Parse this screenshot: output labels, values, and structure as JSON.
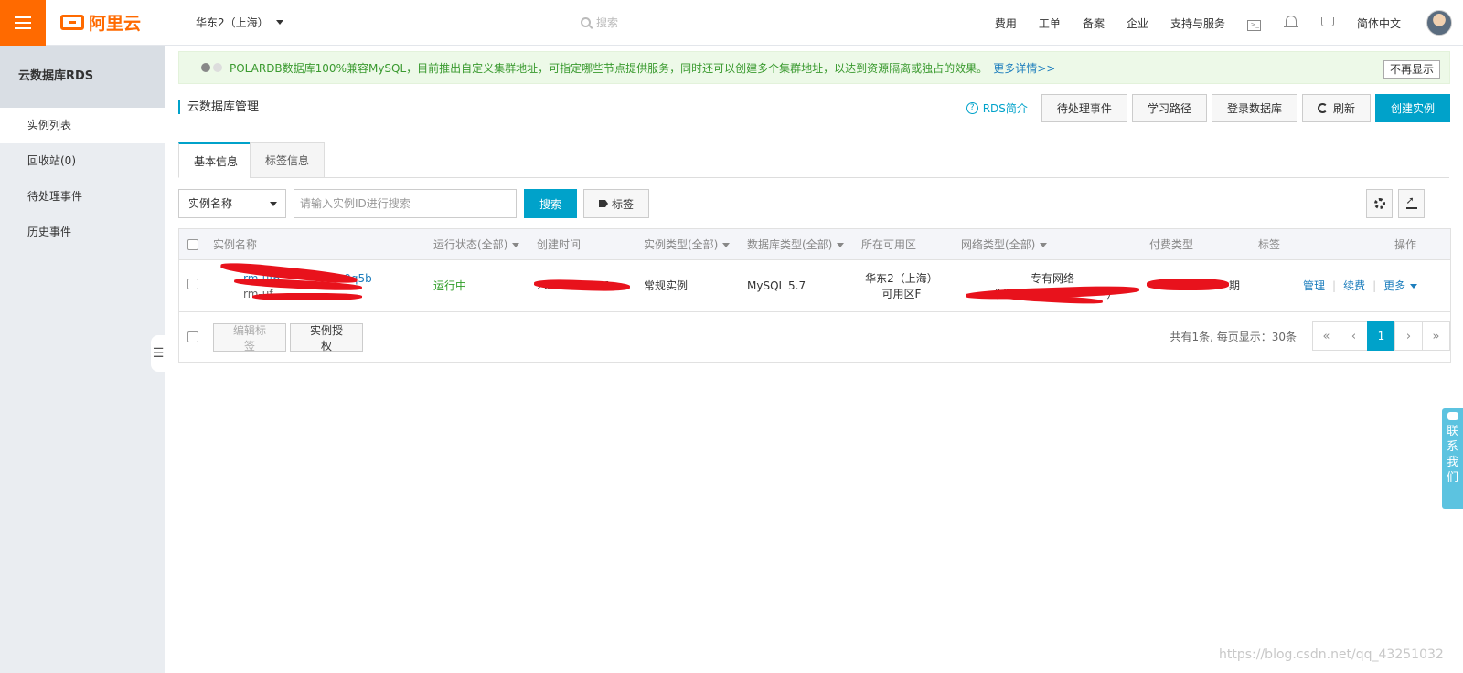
{
  "topbar": {
    "brand": "阿里云",
    "region": "华东2（上海）",
    "search_placeholder": "搜索",
    "links": [
      "费用",
      "工单",
      "备案",
      "企业",
      "支持与服务"
    ],
    "language": "简体中文"
  },
  "sidebar": {
    "title": "云数据库RDS",
    "items": [
      {
        "label": "实例列表"
      },
      {
        "label": "回收站(0)"
      },
      {
        "label": "待处理事件"
      },
      {
        "label": "历史事件"
      }
    ]
  },
  "notice": {
    "text": "POLARDB数据库100%兼容MySQL，目前推出自定义集群地址，可指定哪些节点提供服务，同时还可以创建多个集群地址，以达到资源隔离或独占的效果。",
    "more": "更多详情>>",
    "dismiss": "不再显示"
  },
  "page": {
    "title": "云数据库管理",
    "rds_intro": "RDS简介",
    "buttons": {
      "pending": "待处理事件",
      "learning": "学习路径",
      "login_db": "登录数据库",
      "refresh": "刷新",
      "create": "创建实例"
    }
  },
  "tabs": [
    {
      "label": "基本信息"
    },
    {
      "label": "标签信息"
    }
  ],
  "toolbar": {
    "filter_select": "实例名称",
    "search_placeholder": "请输入实例ID进行搜索",
    "search_button": "搜索",
    "tag_button": "标签"
  },
  "table": {
    "headers": {
      "name": "实例名称",
      "status": "运行状态(全部)",
      "created": "创建时间",
      "instance_type": "实例类型(全部)",
      "db_type": "数据库类型(全部)",
      "zone": "所在可用区",
      "network": "网络类型(全部)",
      "billing": "付费类型",
      "tags": "标签",
      "actions": "操作"
    },
    "row": {
      "name_line1": "rm-uf6",
      "name_line1_end": "9q5b",
      "name_line2": "rm-uf",
      "status": "运行中",
      "created": "2019-05-21 1",
      "instance_type": "常规实例",
      "db_type": "MySQL 5.7",
      "zone_line1": "华东2（上海）",
      "zone_line2": "可用区F",
      "network_line1": "专有网络",
      "network_line2": "（VPC:vpc-uf              ）",
      "billing_end": "期",
      "action_manage": "管理",
      "action_renew": "续费",
      "action_more": "更多"
    },
    "footer": {
      "edit_tags": "编辑标签",
      "authorize": "实例授权",
      "summary": "共有1条, 每页显示：30条",
      "pages": [
        "«",
        "‹",
        "1",
        "›",
        "»"
      ]
    }
  },
  "contact": [
    "联",
    "系",
    "我",
    "们"
  ],
  "watermark": "https://blog.csdn.net/qq_43251032"
}
